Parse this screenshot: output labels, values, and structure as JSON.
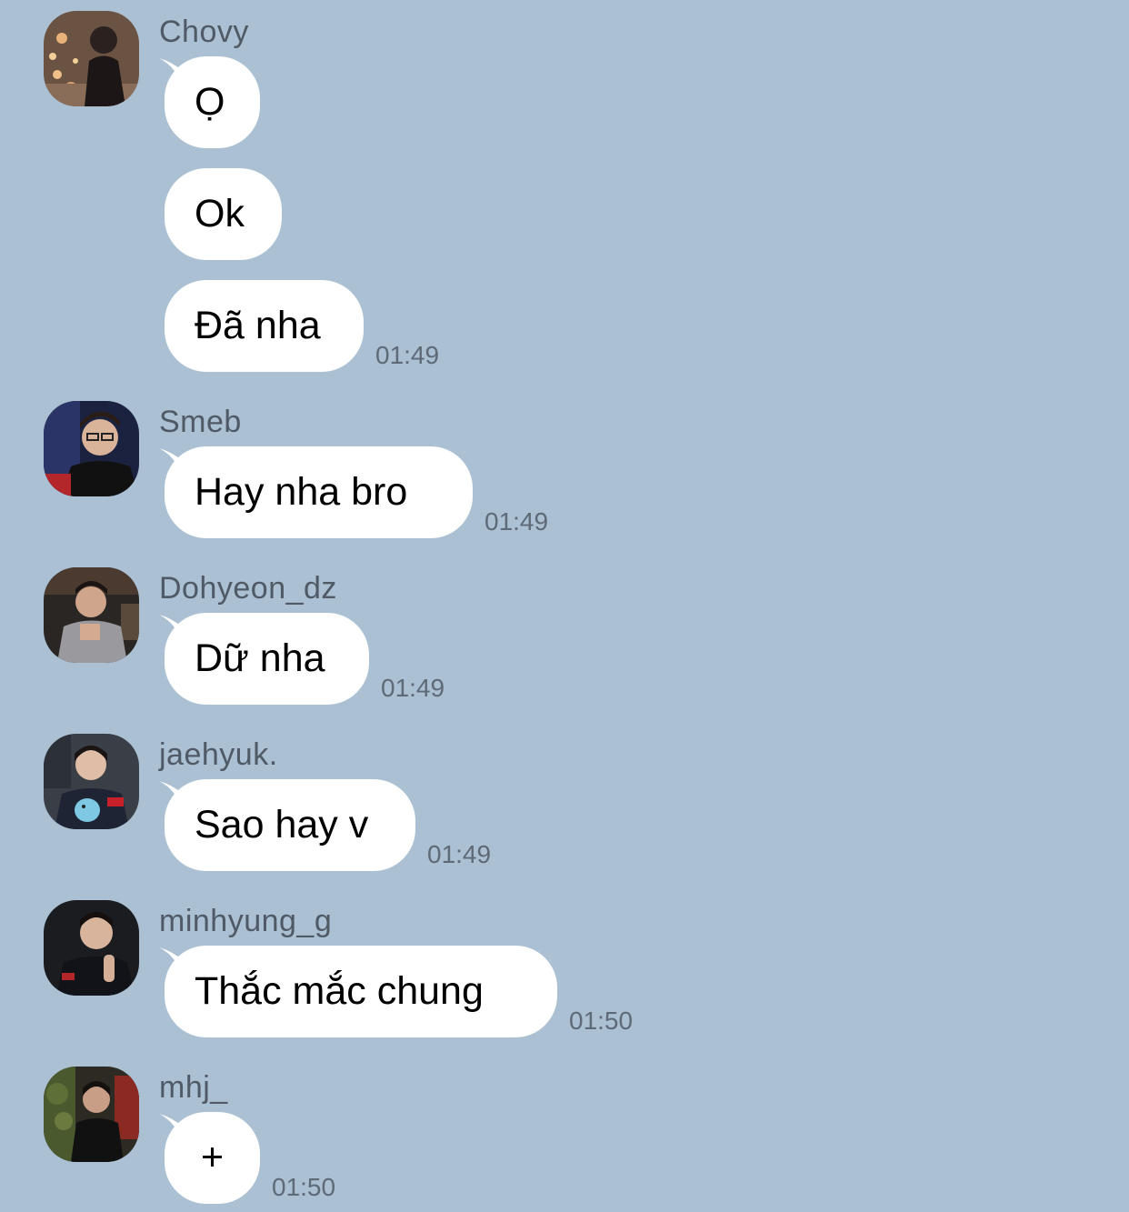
{
  "messages": [
    {
      "sender": "Chovy",
      "bubbles": [
        "Ọ",
        "Ok",
        "Đã nha"
      ],
      "time": "01:49"
    },
    {
      "sender": "Smeb",
      "bubbles": [
        "Hay nha bro"
      ],
      "time": "01:49"
    },
    {
      "sender": "Dohyeon_dz",
      "bubbles": [
        "Dữ nha"
      ],
      "time": "01:49"
    },
    {
      "sender": "jaehyuk.",
      "bubbles": [
        "Sao hay v"
      ],
      "time": "01:49"
    },
    {
      "sender": "minhyung_g",
      "bubbles": [
        "Thắc mắc chung"
      ],
      "time": "01:50"
    },
    {
      "sender": "mhj_",
      "bubbles": [
        "+"
      ],
      "time": "01:50"
    }
  ],
  "colors": {
    "background": "#abc0d3",
    "bubble": "#ffffff",
    "name_text": "#4f5a66",
    "time_text": "#5e6a77"
  }
}
